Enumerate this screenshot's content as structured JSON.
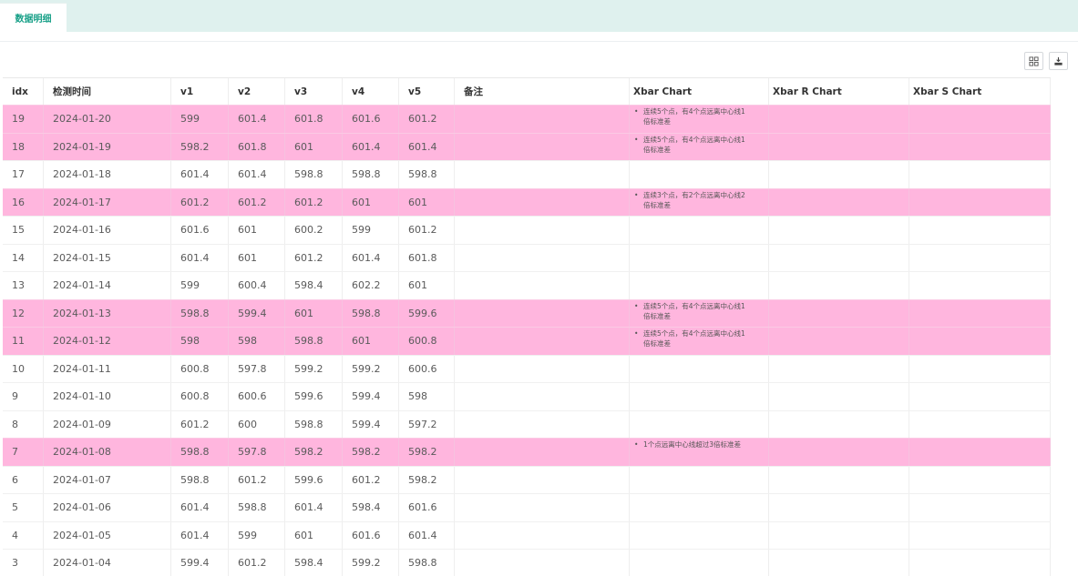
{
  "tab": {
    "label": "数据明细"
  },
  "toolbar": {
    "columns_icon": "columns-icon",
    "export_icon": "export-icon"
  },
  "columns": [
    "idx",
    "检测时间",
    "v1",
    "v2",
    "v3",
    "v4",
    "v5",
    "备注",
    "Xbar Chart",
    "Xbar R Chart",
    "Xbar S Chart"
  ],
  "colors": {
    "highlight": "#ffb6de",
    "tab_text": "#1aa189",
    "tabbar_bg": "#dff1ee"
  },
  "rows": [
    {
      "idx": "19",
      "time": "2024-01-20",
      "v1": "599",
      "v2": "601.4",
      "v3": "601.8",
      "v4": "601.6",
      "v5": "601.2",
      "remark": "",
      "xbar": [
        "连续5个点，有4个点远离中心线1",
        "倍标准差"
      ],
      "xbar_r": "",
      "xbar_s": "",
      "highlight": true
    },
    {
      "idx": "18",
      "time": "2024-01-19",
      "v1": "598.2",
      "v2": "601.8",
      "v3": "601",
      "v4": "601.4",
      "v5": "601.4",
      "remark": "",
      "xbar": [
        "连续5个点，有4个点远离中心线1",
        "倍标准差"
      ],
      "xbar_r": "",
      "xbar_s": "",
      "highlight": true
    },
    {
      "idx": "17",
      "time": "2024-01-18",
      "v1": "601.4",
      "v2": "601.4",
      "v3": "598.8",
      "v4": "598.8",
      "v5": "598.8",
      "remark": "",
      "xbar": [],
      "xbar_r": "",
      "xbar_s": "",
      "highlight": false
    },
    {
      "idx": "16",
      "time": "2024-01-17",
      "v1": "601.2",
      "v2": "601.2",
      "v3": "601.2",
      "v4": "601",
      "v5": "601",
      "remark": "",
      "xbar": [
        "连续3个点，有2个点远离中心线2",
        "倍标准差"
      ],
      "xbar_r": "",
      "xbar_s": "",
      "highlight": true
    },
    {
      "idx": "15",
      "time": "2024-01-16",
      "v1": "601.6",
      "v2": "601",
      "v3": "600.2",
      "v4": "599",
      "v5": "601.2",
      "remark": "",
      "xbar": [],
      "xbar_r": "",
      "xbar_s": "",
      "highlight": false
    },
    {
      "idx": "14",
      "time": "2024-01-15",
      "v1": "601.4",
      "v2": "601",
      "v3": "601.2",
      "v4": "601.4",
      "v5": "601.8",
      "remark": "",
      "xbar": [],
      "xbar_r": "",
      "xbar_s": "",
      "highlight": false
    },
    {
      "idx": "13",
      "time": "2024-01-14",
      "v1": "599",
      "v2": "600.4",
      "v3": "598.4",
      "v4": "602.2",
      "v5": "601",
      "remark": "",
      "xbar": [],
      "xbar_r": "",
      "xbar_s": "",
      "highlight": false
    },
    {
      "idx": "12",
      "time": "2024-01-13",
      "v1": "598.8",
      "v2": "599.4",
      "v3": "601",
      "v4": "598.8",
      "v5": "599.6",
      "remark": "",
      "xbar": [
        "连续5个点，有4个点远离中心线1",
        "倍标准差"
      ],
      "xbar_r": "",
      "xbar_s": "",
      "highlight": true
    },
    {
      "idx": "11",
      "time": "2024-01-12",
      "v1": "598",
      "v2": "598",
      "v3": "598.8",
      "v4": "601",
      "v5": "600.8",
      "remark": "",
      "xbar": [
        "连续5个点，有4个点远离中心线1",
        "倍标准差"
      ],
      "xbar_r": "",
      "xbar_s": "",
      "highlight": true
    },
    {
      "idx": "10",
      "time": "2024-01-11",
      "v1": "600.8",
      "v2": "597.8",
      "v3": "599.2",
      "v4": "599.2",
      "v5": "600.6",
      "remark": "",
      "xbar": [],
      "xbar_r": "",
      "xbar_s": "",
      "highlight": false
    },
    {
      "idx": "9",
      "time": "2024-01-10",
      "v1": "600.8",
      "v2": "600.6",
      "v3": "599.6",
      "v4": "599.4",
      "v5": "598",
      "remark": "",
      "xbar": [],
      "xbar_r": "",
      "xbar_s": "",
      "highlight": false
    },
    {
      "idx": "8",
      "time": "2024-01-09",
      "v1": "601.2",
      "v2": "600",
      "v3": "598.8",
      "v4": "599.4",
      "v5": "597.2",
      "remark": "",
      "xbar": [],
      "xbar_r": "",
      "xbar_s": "",
      "highlight": false
    },
    {
      "idx": "7",
      "time": "2024-01-08",
      "v1": "598.8",
      "v2": "597.8",
      "v3": "598.2",
      "v4": "598.2",
      "v5": "598.2",
      "remark": "",
      "xbar": [
        "1个点远离中心线超过3倍标准差"
      ],
      "xbar_r": "",
      "xbar_s": "",
      "highlight": true
    },
    {
      "idx": "6",
      "time": "2024-01-07",
      "v1": "598.8",
      "v2": "601.2",
      "v3": "599.6",
      "v4": "601.2",
      "v5": "598.2",
      "remark": "",
      "xbar": [],
      "xbar_r": "",
      "xbar_s": "",
      "highlight": false
    },
    {
      "idx": "5",
      "time": "2024-01-06",
      "v1": "601.4",
      "v2": "598.8",
      "v3": "601.4",
      "v4": "598.4",
      "v5": "601.6",
      "remark": "",
      "xbar": [],
      "xbar_r": "",
      "xbar_s": "",
      "highlight": false
    },
    {
      "idx": "4",
      "time": "2024-01-05",
      "v1": "601.4",
      "v2": "599",
      "v3": "601",
      "v4": "601.6",
      "v5": "601.4",
      "remark": "",
      "xbar": [],
      "xbar_r": "",
      "xbar_s": "",
      "highlight": false
    },
    {
      "idx": "3",
      "time": "2024-01-04",
      "v1": "599.4",
      "v2": "601.2",
      "v3": "598.4",
      "v4": "599.2",
      "v5": "598.8",
      "remark": "",
      "xbar": [],
      "xbar_r": "",
      "xbar_s": "",
      "highlight": false
    }
  ]
}
